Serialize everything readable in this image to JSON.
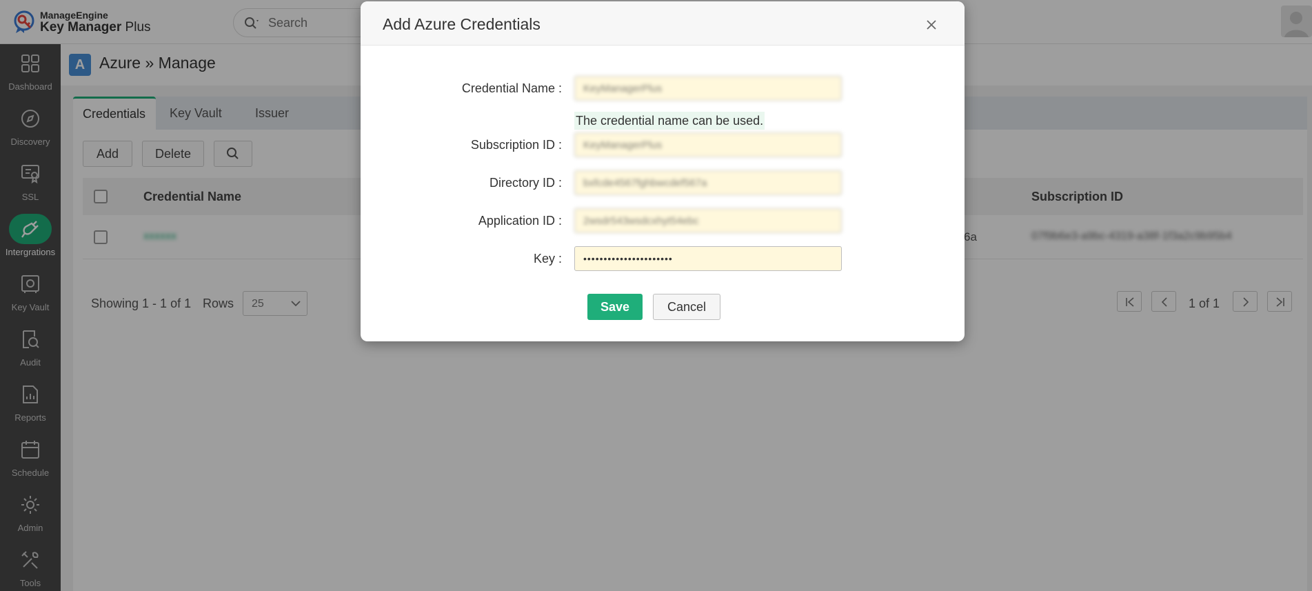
{
  "header": {
    "brand_small": "ManageEngine",
    "brand_name_bold": "Key Manager",
    "brand_name_rest": " Plus",
    "search_placeholder": "Search"
  },
  "sidebar": {
    "items": [
      {
        "label": "Dashboard",
        "icon": "dashboard-icon"
      },
      {
        "label": "Discovery",
        "icon": "compass-icon"
      },
      {
        "label": "SSL",
        "icon": "certificate-icon"
      },
      {
        "label": "Intergrations",
        "icon": "plug-icon",
        "active": true
      },
      {
        "label": "Key Vault",
        "icon": "vault-icon"
      },
      {
        "label": "Audit",
        "icon": "audit-icon"
      },
      {
        "label": "Reports",
        "icon": "reports-icon"
      },
      {
        "label": "Schedule",
        "icon": "calendar-icon"
      },
      {
        "label": "Admin",
        "icon": "gear-icon"
      },
      {
        "label": "Tools",
        "icon": "tools-icon"
      }
    ]
  },
  "page": {
    "icon_letter": "A",
    "title": "Azure » Manage"
  },
  "tabs": [
    {
      "label": "Credentials",
      "active": true
    },
    {
      "label": "Key Vault"
    },
    {
      "label": "Issuer"
    }
  ],
  "toolbar": {
    "add_label": "Add",
    "delete_label": "Delete"
  },
  "table": {
    "columns": [
      "Credential Name",
      "Subscription ID"
    ],
    "row": {
      "name": "xxxxxx",
      "middle_tail": "6a",
      "subscription": "07f9b6e3-a9bc-4319-a38f-1f3a2c9b95b4"
    }
  },
  "footer": {
    "showing": "Showing 1 - 1 of 1",
    "rows_label": "Rows",
    "rows_value": "25",
    "page_text": "1 of 1"
  },
  "modal": {
    "title": "Add Azure Credentials",
    "fields": [
      {
        "label": "Credential Name",
        "value": "KeyManagerPlus"
      },
      {
        "label": "Subscription ID",
        "value": "KeyManagerPlus"
      },
      {
        "label": "Directory ID",
        "value": "bxfcde4567fghbwcdef567a"
      },
      {
        "label": "Application ID",
        "value": "2wsdr543wsdcxhyt54ebc"
      },
      {
        "label": "Key",
        "value": "••••••••••••••••••••••"
      }
    ],
    "hint": "The credential name can be used.",
    "label_suffix": ":",
    "save_label": "Save",
    "cancel_label": "Cancel"
  },
  "colors": {
    "accent": "#1fae7a",
    "sidebar_bg": "#4a4a4a",
    "input_bg": "#fff8dc"
  }
}
